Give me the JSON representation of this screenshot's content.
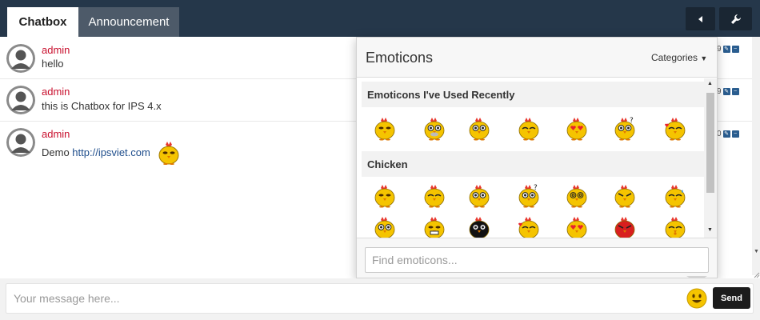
{
  "tabs": {
    "chatbox": "Chatbox",
    "announcement": "Announcement"
  },
  "messages": [
    {
      "user": "admin",
      "text": "hello",
      "meta": "9"
    },
    {
      "user": "admin",
      "text": "this is Chatbox for IPS 4.x",
      "meta": "9"
    },
    {
      "user": "admin",
      "text": "Demo ",
      "link": "http://ipsviet.com",
      "meta": "0"
    }
  ],
  "emoticons": {
    "title": "Emoticons",
    "categories_label": "Categories",
    "recent_heading": "Emoticons I've Used Recently",
    "chicken_heading": "Chicken",
    "search_placeholder": "Find emoticons...",
    "recent": [
      "chicken-happy",
      "chicken-tired",
      "chicken-surprised",
      "chicken-sleepy",
      "chicken-love",
      "chicken-confused",
      "chicken-kiss"
    ],
    "chicken": [
      "chicken-happy",
      "chicken-smirk",
      "chicken-shocked",
      "chicken-confused",
      "chicken-dizzy",
      "chicken-angry",
      "chicken-sweat",
      "chicken-smile",
      "chicken-grin",
      "chicken-black",
      "chicken-kiss",
      "chicken-love",
      "chicken-red-angry",
      "chicken-whistle"
    ]
  },
  "composer": {
    "placeholder": "Your message here...",
    "send_label": "Send"
  },
  "colors": {
    "topbar": "#25374a",
    "username": "#c8102e",
    "send": "#1c1c1c",
    "chicken": "#f5c400"
  }
}
